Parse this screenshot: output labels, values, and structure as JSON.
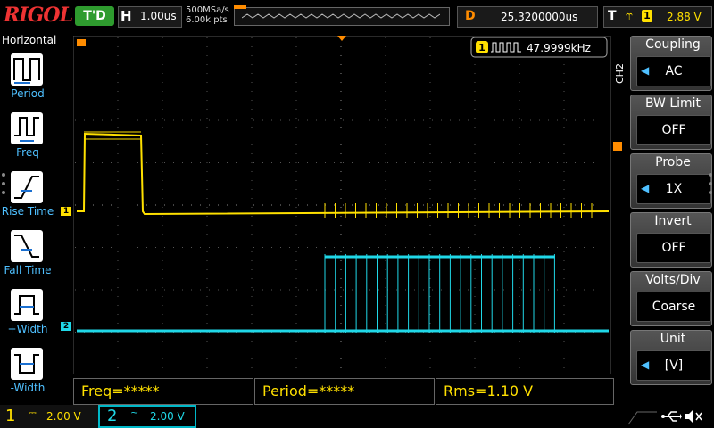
{
  "topbar": {
    "logo": "RIGOL",
    "run_state": "T'D",
    "horizontal_tag": "H",
    "timebase": "1.00us",
    "sample_rate": "500MSa/s",
    "memory_depth": "6.00k pts",
    "delay_tag": "D",
    "delay_value": "25.3200000us",
    "trigger_tag": "T",
    "trigger_edge": "⥾",
    "trigger_source": "1",
    "trigger_level": "2.88 V"
  },
  "left_menu": {
    "title": "Horizontal",
    "items": [
      {
        "label": "Period",
        "icon": "period-icon"
      },
      {
        "label": "Freq",
        "icon": "freq-icon"
      },
      {
        "label": "Rise Time",
        "icon": "rise-time-icon"
      },
      {
        "label": "Fall Time",
        "icon": "fall-time-icon"
      },
      {
        "label": "+Width",
        "icon": "positive-width-icon"
      },
      {
        "label": "-Width",
        "icon": "negative-width-icon"
      }
    ]
  },
  "screen": {
    "freq_counter_channel": "1",
    "freq_counter_value": "47.9999kHz",
    "ch1_marker": "1",
    "ch2_marker": "2"
  },
  "right_menu": {
    "channel_label": "CH2",
    "items": [
      {
        "title": "Coupling",
        "value": "AC",
        "has_arrow": true
      },
      {
        "title": "BW Limit",
        "value": "OFF",
        "has_arrow": false
      },
      {
        "title": "Probe",
        "value": "1X",
        "has_arrow": true
      },
      {
        "title": "Invert",
        "value": "OFF",
        "has_arrow": false
      },
      {
        "title": "Volts/Div",
        "value": "Coarse",
        "has_arrow": false
      },
      {
        "title": "Unit",
        "value": "[V]",
        "has_arrow": true
      }
    ]
  },
  "measurements": {
    "freq": "Freq=*****",
    "period": "Period=*****",
    "rms": "Rms=1.10 V"
  },
  "bottom": {
    "ch1_num": "1",
    "ch1_coupling": "⎓",
    "ch1_scale": "2.00 V",
    "ch2_num": "2",
    "ch2_coupling": "~",
    "ch2_scale": "2.00 V"
  },
  "colors": {
    "ch1": "#ffe000",
    "ch2": "#20d8e8",
    "accent": "#4fc0ff",
    "trigger_marker": "#ff8c00"
  }
}
